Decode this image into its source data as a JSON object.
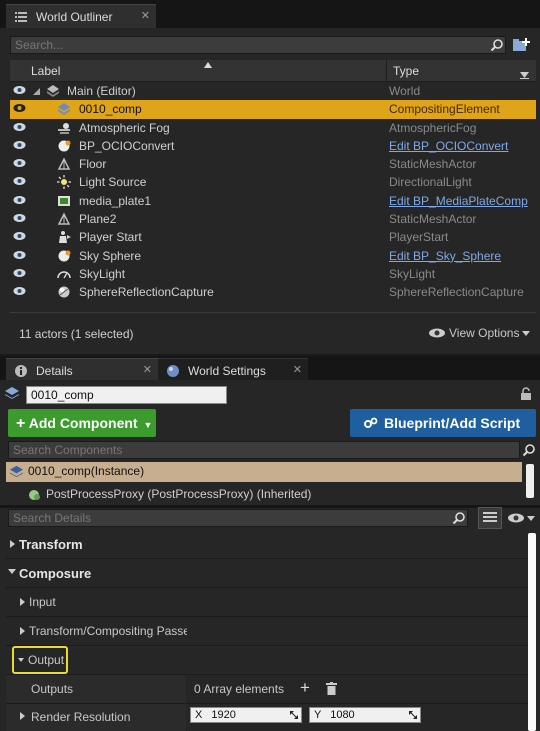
{
  "outliner": {
    "tab_title": "World Outliner",
    "search_placeholder": "Search...",
    "col_label": "Label",
    "col_type": "Type",
    "rows": [
      {
        "label": "Main (Editor)",
        "type": "World",
        "icon": "world-icon",
        "indent": 1,
        "link": false,
        "selected": false
      },
      {
        "label": "0010_comp",
        "type": "CompositingElement",
        "icon": "layers-icon",
        "indent": 2,
        "link": false,
        "selected": true
      },
      {
        "label": "Atmospheric Fog",
        "type": "AtmosphericFog",
        "icon": "fog-icon",
        "indent": 2,
        "link": false,
        "selected": false
      },
      {
        "label": "BP_OCIOConvert",
        "type": "Edit BP_OCIOConvert",
        "icon": "sphere-icon",
        "indent": 2,
        "link": true,
        "selected": false
      },
      {
        "label": "Floor",
        "type": "StaticMeshActor",
        "icon": "mesh-icon",
        "indent": 2,
        "link": false,
        "selected": false
      },
      {
        "label": "Light Source",
        "type": "DirectionalLight",
        "icon": "sun-icon",
        "indent": 2,
        "link": false,
        "selected": false
      },
      {
        "label": "media_plate1",
        "type": "Edit BP_MediaPlateComp",
        "icon": "film-icon",
        "indent": 2,
        "link": true,
        "selected": false
      },
      {
        "label": "Plane2",
        "type": "StaticMeshActor",
        "icon": "mesh-icon",
        "indent": 2,
        "link": false,
        "selected": false
      },
      {
        "label": "Player Start",
        "type": "PlayerStart",
        "icon": "player-start-icon",
        "indent": 2,
        "link": false,
        "selected": false
      },
      {
        "label": "Sky Sphere",
        "type": "Edit BP_Sky_Sphere",
        "icon": "sphere-icon",
        "indent": 2,
        "link": true,
        "selected": false
      },
      {
        "label": "SkyLight",
        "type": "SkyLight",
        "icon": "skylight-icon",
        "indent": 2,
        "link": false,
        "selected": false
      },
      {
        "label": "SphereReflectionCapture",
        "type": "SphereReflectionCapture",
        "icon": "reflection-icon",
        "indent": 2,
        "link": false,
        "selected": false
      }
    ],
    "status": "11 actors (1 selected)",
    "view_options": "View Options"
  },
  "details": {
    "tab_details": "Details",
    "tab_world_settings": "World Settings",
    "name_value": "0010_comp",
    "add_component": "Add Component",
    "blueprint_script": "Blueprint/Add Script",
    "search_components": "Search Components",
    "instance_label": "0010_comp(Instance)",
    "child_component": "PostProcessProxy (PostProcessProxy) (Inherited)",
    "search_details": "Search Details",
    "categories": {
      "transform": "Transform",
      "composure": "Composure",
      "input": "Input",
      "passes": "Transform/Compositing Passes",
      "output": "Output",
      "outputs": "Outputs",
      "array_text": "0 Array elements",
      "render_resolution": "Render Resolution",
      "res_x_label": "X",
      "res_x_value": "1920",
      "res_y_label": "Y",
      "res_y_value": "1080"
    }
  },
  "colors": {
    "selection": "#e0a419",
    "link": "#7fa9e6",
    "green_button": "#3b9b2c",
    "blue_button": "#1f5f9f",
    "instance_row": "#c7ae8e"
  }
}
